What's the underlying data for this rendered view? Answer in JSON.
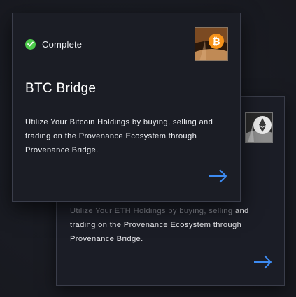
{
  "cards": [
    {
      "status": "Complete",
      "title": "BTC Bridge",
      "description": "Utilize Your Bitcoin Holdings by buying, selling and trading on the Provenance Ecosystem through Provenance Bridge.",
      "icon": "bitcoin-icon"
    },
    {
      "description_hidden_part": "Utilize Your ETH Holdings by buying, selling",
      "description_visible_part": "and trading on the Provenance Ecosystem through Provenance Bridge.",
      "icon": "ethereum-icon"
    }
  ],
  "colors": {
    "background": "#1a1c24",
    "card": "#1b1d25",
    "card_border": "#3b3e4b",
    "status_green": "#4cc94a",
    "arrow_blue": "#3d8bf2",
    "bitcoin_orange": "#f7931a"
  }
}
